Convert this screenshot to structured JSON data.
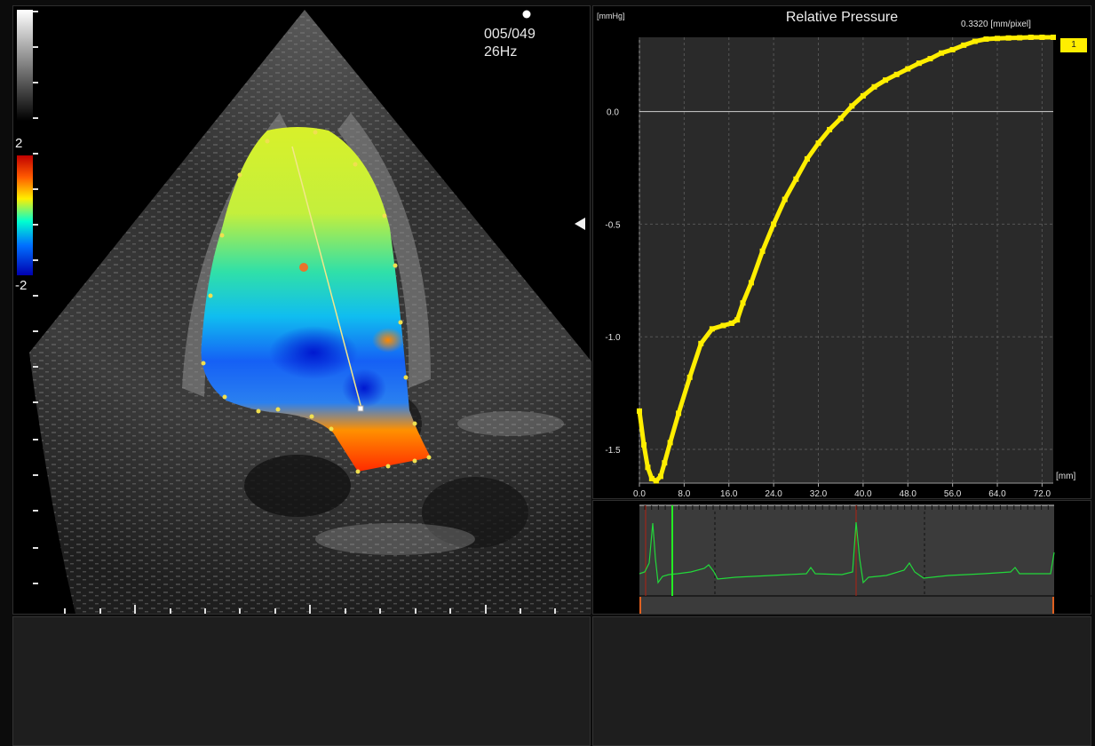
{
  "echo": {
    "frame": "005/049",
    "rate": "26Hz",
    "colorbar_max": "2",
    "colorbar_min": "-2"
  },
  "chart": {
    "title": "Relative Pressure",
    "resolution": "0.3320 [mm/pixel]",
    "y_unit": "[mmHg]",
    "x_unit": "[mm]",
    "series_tag": "1",
    "y_ticks": [
      "0.0",
      "-0.5",
      "-1.0",
      "-1.5"
    ],
    "x_ticks": [
      "0.0",
      "8.0",
      "16.0",
      "24.0",
      "32.0",
      "40.0",
      "48.0",
      "56.0",
      "64.0",
      "72.0"
    ]
  },
  "chart_data": {
    "type": "line",
    "title": "Relative Pressure",
    "xlabel": "[mm]",
    "ylabel": "[mmHg]",
    "xlim": [
      0,
      74
    ],
    "ylim": [
      -1.65,
      0.33
    ],
    "grid": true,
    "series": [
      {
        "name": "1",
        "color": "#ffee00",
        "x": [
          0,
          0.8,
          1.5,
          2.2,
          3,
          3.8,
          4.5,
          5.5,
          7,
          9,
          11,
          13,
          15,
          16.5,
          17.5,
          18.5,
          20,
          22,
          24,
          26,
          28,
          30,
          32,
          34,
          36,
          38,
          40,
          42,
          44,
          46,
          48,
          50,
          52,
          54,
          56,
          58,
          60,
          62,
          64,
          66,
          68,
          70,
          72,
          74
        ],
        "y": [
          -1.33,
          -1.48,
          -1.58,
          -1.63,
          -1.64,
          -1.62,
          -1.56,
          -1.47,
          -1.34,
          -1.18,
          -1.03,
          -0.965,
          -0.95,
          -0.94,
          -0.925,
          -0.85,
          -0.76,
          -0.62,
          -0.5,
          -0.39,
          -0.3,
          -0.21,
          -0.14,
          -0.08,
          -0.03,
          0.025,
          0.07,
          0.11,
          0.14,
          0.165,
          0.19,
          0.215,
          0.235,
          0.26,
          0.275,
          0.295,
          0.312,
          0.322,
          0.325,
          0.327,
          0.328,
          0.33,
          0.33,
          0.33
        ]
      }
    ]
  },
  "colors": {
    "curve": "#ffee00",
    "ecg": "#22d83a",
    "cursor": "#22ee22",
    "marker": "#e04020"
  }
}
